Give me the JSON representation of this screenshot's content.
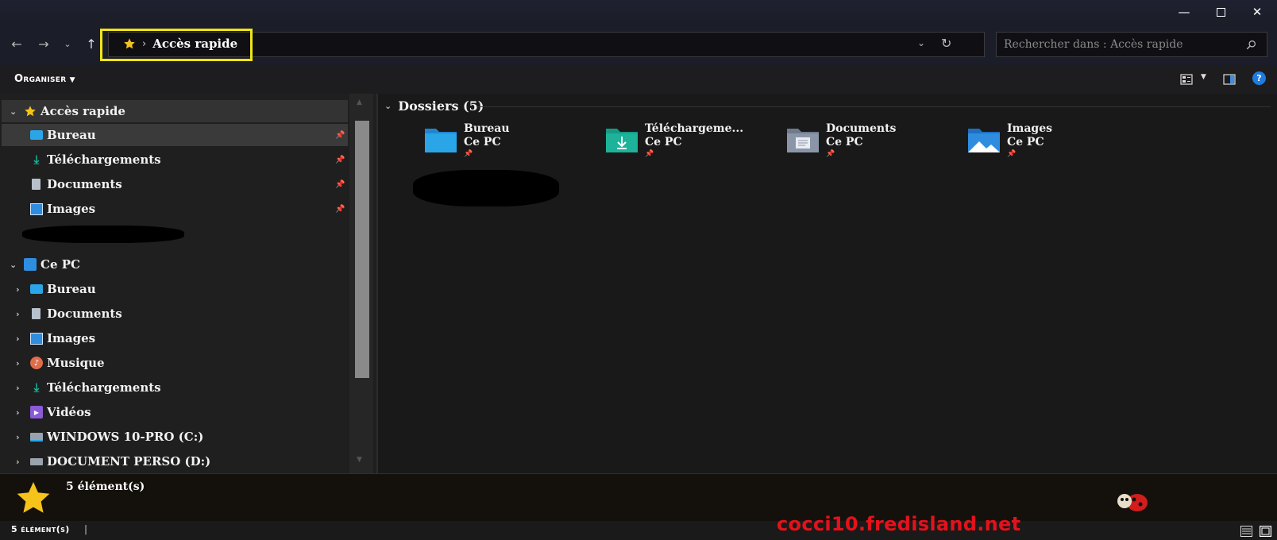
{
  "window": {
    "minimize_icon": "minimize-icon",
    "maximize_icon": "maximize-icon",
    "close_icon": "close-icon"
  },
  "nav": {
    "breadcrumb_root": "Accès rapide",
    "search_placeholder": "Rechercher dans : Accès rapide"
  },
  "toolbar": {
    "organiser_label": "Organiser"
  },
  "sidebar": {
    "quick_access": {
      "label": "Accès rapide",
      "items": [
        {
          "label": "Bureau",
          "icon": "desktop-icon"
        },
        {
          "label": "Téléchargements",
          "icon": "download-icon"
        },
        {
          "label": "Documents",
          "icon": "document-icon"
        },
        {
          "label": "Images",
          "icon": "image-icon"
        }
      ]
    },
    "this_pc": {
      "label": "Ce PC",
      "items": [
        {
          "label": "Bureau",
          "icon": "desktop-icon"
        },
        {
          "label": "Documents",
          "icon": "document-icon"
        },
        {
          "label": "Images",
          "icon": "image-icon"
        },
        {
          "label": "Musique",
          "icon": "music-icon"
        },
        {
          "label": "Téléchargements",
          "icon": "download-icon"
        },
        {
          "label": "Vidéos",
          "icon": "video-icon"
        },
        {
          "label": "WINDOWS 10-PRO (C:)",
          "icon": "drive-icon"
        },
        {
          "label": "DOCUMENT PERSO (D:)",
          "icon": "drive-icon"
        }
      ]
    }
  },
  "content": {
    "group_header": "Dossiers (5)",
    "folders": [
      {
        "name": "Bureau",
        "location": "Ce PC",
        "color": "#2aa6e8"
      },
      {
        "name": "Téléchargeme...",
        "location": "Ce PC",
        "color": "#1db39a"
      },
      {
        "name": "Documents",
        "location": "Ce PC",
        "color": "#8a96a8"
      },
      {
        "name": "Images",
        "location": "Ce PC",
        "color": "#2f8de0"
      }
    ]
  },
  "details": {
    "count": "5 élément(s)"
  },
  "status": {
    "count": "5 élément(s)"
  },
  "watermark": "cocci10.fredisland.net",
  "colors": {
    "accent_star": "#f6c31a",
    "highlight": "#f0e517",
    "watermark": "#e4121a"
  }
}
